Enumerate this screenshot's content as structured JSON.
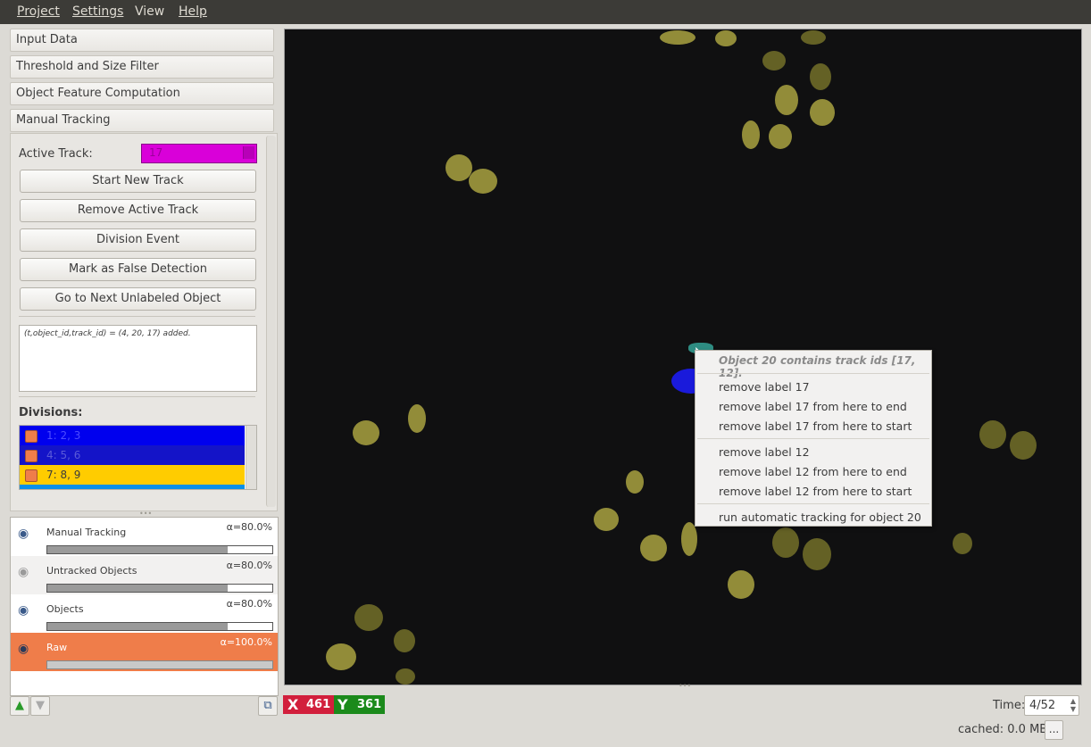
{
  "menubar": {
    "items": [
      "Project",
      "Settings",
      "View",
      "Help"
    ]
  },
  "applets": {
    "input_data": "Input Data",
    "threshold": "Threshold and Size Filter",
    "features": "Object Feature Computation",
    "manual_tracking": "Manual Tracking"
  },
  "tracking": {
    "active_track_label": "Active Track:",
    "active_track_value": "17",
    "buttons": {
      "start_new": "Start New Track",
      "remove_active": "Remove Active Track",
      "division": "Division Event",
      "false_detection": "Mark as False Detection",
      "next_unlabeled": "Go to Next Unlabeled Object"
    },
    "log": "(t,object_id,track_id) = (4, 20, 17) added.",
    "divisions_label": "Divisions:",
    "divisions": [
      "1: 2, 3",
      "4: 5, 6",
      "7: 8, 9"
    ]
  },
  "layers": [
    {
      "name": "Manual Tracking",
      "alpha": "α=80.0%",
      "level": 0.8
    },
    {
      "name": "Untracked Objects",
      "alpha": "α=80.0%",
      "level": 0.8
    },
    {
      "name": "Objects",
      "alpha": "α=80.0%",
      "level": 0.8
    },
    {
      "name": "Raw",
      "alpha": "α=100.0%",
      "level": 1.0
    }
  ],
  "context_menu": {
    "header": "Object 20 contains track ids [17, 12].",
    "items": [
      "remove label 17",
      "remove label 17 from here to end",
      "remove label 17 from here to start",
      "remove label 12",
      "remove label 12 from here to end",
      "remove label 12 from here to start",
      "run automatic tracking for object 20"
    ]
  },
  "coords": {
    "x_label": "X",
    "x_value": "461",
    "y_label": "Y",
    "y_value": "361"
  },
  "time": {
    "label": "Time:",
    "value": "4/52"
  },
  "status": {
    "cached": "cached: 0.0 MB",
    "more": "..."
  },
  "colors": {
    "active_track": "#d900d9",
    "division_1": "#0000ee",
    "division_2": "#1414c8",
    "division_3": "#ffcc00",
    "raw_layer": "#ef7d4a",
    "x_coord": "#d21f3c",
    "y_coord": "#1b8a1b"
  }
}
